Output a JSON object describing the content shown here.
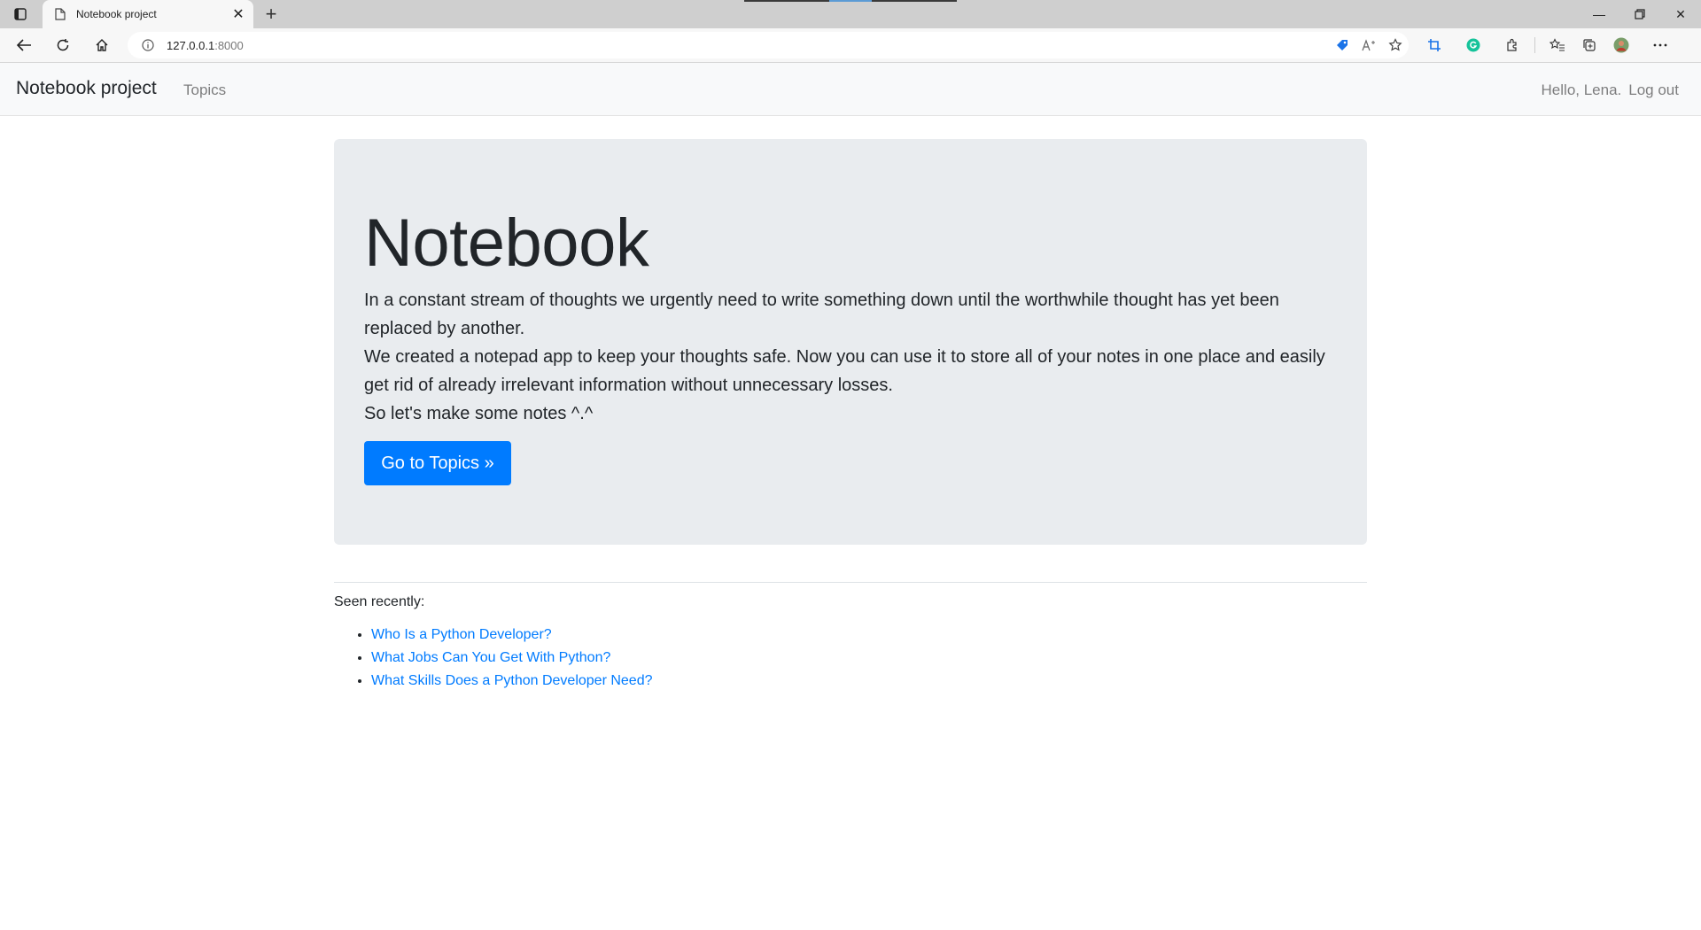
{
  "browser": {
    "tab_title": "Notebook project",
    "url_host": "127.0.0.1",
    "url_port": ":8000"
  },
  "navbar": {
    "brand": "Notebook project",
    "topics_link": "Topics",
    "greeting": "Hello, Lena.",
    "logout": "Log out"
  },
  "hero": {
    "title": "Notebook",
    "paragraphs": [
      "In a constant stream of thoughts we urgently need to write something down until the worthwhile thought has yet been replaced by another.",
      "We created a notepad app to keep your thoughts safe. Now you can use it to store all of your notes in one place and easily get rid of already irrelevant information without unnecessary losses.",
      "So let's make some notes ^.^"
    ],
    "button_label": "Go to Topics »"
  },
  "recent": {
    "label": "Seen recently:",
    "items": [
      "Who Is a Python Developer?",
      "What Jobs Can You Get With Python?",
      "What Skills Does a Python Developer Need?"
    ]
  },
  "colors": {
    "primary": "#007bff",
    "jumbotron_bg": "#e9ecef",
    "navbar_bg": "#f8f9fa"
  }
}
